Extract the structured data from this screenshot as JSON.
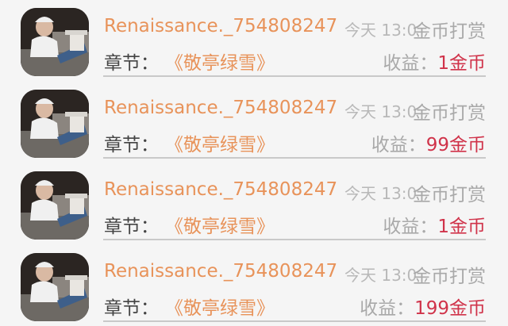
{
  "records": [
    {
      "name": "Renaissance._754808247",
      "time": "今天 13:0",
      "type": "金币打赏",
      "chapter_label": "章节：",
      "chapter_title": "《敬亭绿雪》",
      "income_label": "收益：",
      "income_value": "1金币"
    },
    {
      "name": "Renaissance._754808247",
      "time": "今天 13:0",
      "type": "金币打赏",
      "chapter_label": "章节：",
      "chapter_title": "《敬亭绿雪》",
      "income_label": "收益：",
      "income_value": "99金币"
    },
    {
      "name": "Renaissance._754808247",
      "time": "今天 13:0",
      "type": "金币打赏",
      "chapter_label": "章节：",
      "chapter_title": "《敬亭绿雪》",
      "income_label": "收益：",
      "income_value": "1金币"
    },
    {
      "name": "Renaissance._754808247",
      "time": "今天 13:0",
      "type": "金币打赏",
      "chapter_label": "章节：",
      "chapter_title": "《敬亭绿雪》",
      "income_label": "收益：",
      "income_value": "199金币"
    }
  ]
}
